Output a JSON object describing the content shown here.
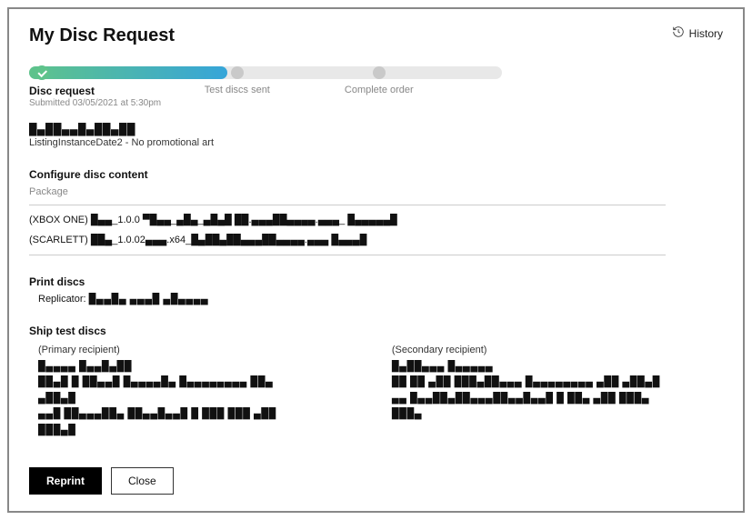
{
  "header": {
    "title": "My Disc Request",
    "history_label": "History"
  },
  "progress": {
    "steps": [
      {
        "label": "Disc request",
        "sub": "Submitted 03/05/2021 at 5:30pm",
        "active": true
      },
      {
        "label": "Test discs sent",
        "active": false
      },
      {
        "label": "Complete order",
        "active": false
      }
    ]
  },
  "product": {
    "name_redacted": "█▄██▄▄█▄██▄██",
    "listing_line": "ListingInstanceDate2 - No promotional art"
  },
  "configure": {
    "title": "Configure disc content",
    "package_label": "Package",
    "packages": [
      "(XBOX ONE) █▄▄_1.0.0 ▀█▄▄_▄█▄_▄█▄█ ██.▄▄▄██▄▄▄▄.▄▄▄_ █▄▄▄▄▄█",
      "(SCARLETT) ██▄_1.0.02▄▄▄.x64_█▄██▄██▄▄▄██▄▄▄▄.▄▄▄ █▄▄▄█"
    ]
  },
  "print": {
    "title": "Print discs",
    "replicator_label": "Replicator:",
    "replicator_value": "█▄▄█▄ ▄▄▄█ ▄█▄▄▄▄"
  },
  "ship": {
    "title": "Ship test discs",
    "primary": {
      "label": "(Primary recipient)",
      "name": "█▄▄▄▄ █▄▄█▄██",
      "address": "██▄█   █ ██▄▄█ █▄▄▄▄█▄ █▄▄▄▄▄▄▄▄ ██▄ ▄██▄█",
      "contact": "▄▄█ ██▄▄▄██▄ ██▄▄█▄▄█   █ ███ ███ ▄██ ███▄█"
    },
    "secondary": {
      "label": "(Secondary recipient)",
      "name": "█▄██▄▄▄ █▄▄▄▄▄",
      "address": "██ ██ ▄██ ███▄██▄▄▄ █▄▄▄▄▄▄▄▄ ▄██ ▄██▄█",
      "contact": "▄▄ █▄▄██▄██▄▄▄██▄▄█▄▄█   █ ██▄ ▄██ ███▄ ███▄"
    }
  },
  "footer": {
    "reprint": "Reprint",
    "close": "Close"
  }
}
